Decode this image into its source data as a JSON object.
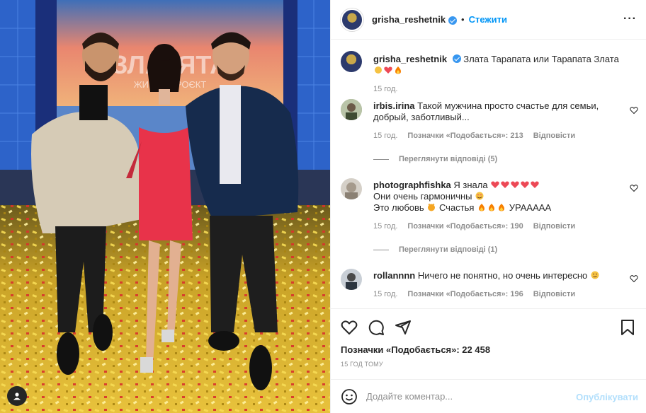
{
  "post": {
    "author": "grisha_reshetnik",
    "follow_label": "Стежити",
    "more_icon": "more-horizontal-icon",
    "caption": "Злата Тарапата или Тарапата Злата",
    "caption_time": "15 год.",
    "backdrop_letters": "ЗЛАТЯТА",
    "backdrop_sub": "ЖИТТЯ ПРОЄКТ"
  },
  "comments": [
    {
      "user": "irbis.irina",
      "text_lines": [
        "Такой мужчина просто счастье для семьи,",
        "добрый, заботливый..."
      ],
      "time": "15 год.",
      "likes": "Позначки «Подобається»: 213",
      "reply": "Відповісти",
      "view_replies": "Переглянути відповіді (5)"
    },
    {
      "user": "photographfishka",
      "text_lines": [
        "Я знала",
        "Они очень гармоничны",
        "Это любовь",
        "Счастья",
        "УРААААА"
      ],
      "time": "15 год.",
      "likes": "Позначки «Подобається»: 190",
      "reply": "Відповісти",
      "view_replies": "Переглянути відповіді (1)"
    },
    {
      "user": "rollannnn",
      "text_lines": [
        "Ничего не понятно, но очень интересно"
      ],
      "time": "15 год.",
      "likes": "Позначки «Подобається»: 196",
      "reply": "Відповісти"
    }
  ],
  "actions": {
    "likes_total": "Позначки «Подобається»: 22 458",
    "time_ago": "15 ГОД ТОМУ",
    "icons": [
      "heart-icon",
      "comment-icon",
      "share-icon",
      "bookmark-icon"
    ]
  },
  "composer": {
    "placeholder": "Додайте коментар...",
    "publish_label": "Опублікувати",
    "emoji_icon": "emoji-icon"
  },
  "colors": {
    "accent": "#0095f6",
    "verified": "#3897f0",
    "muted": "#8e8e8e",
    "publish_disabled": "#b2dffc",
    "heart_red": "#ed4956"
  }
}
